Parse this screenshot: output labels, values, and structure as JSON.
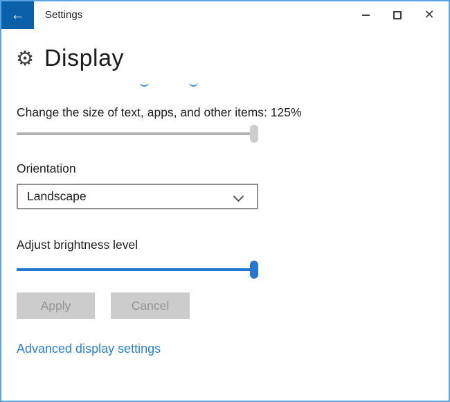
{
  "window": {
    "title": "Settings",
    "back_glyph": "←",
    "close_glyph": "✕",
    "border_color": "#56a4e8",
    "back_button_color": "#0b61a9"
  },
  "page": {
    "title": "Display",
    "icon": "gear-icon",
    "gear_glyph": "⚙",
    "clipped_link_marks": "two partially visible blue link-text descenders above first label"
  },
  "scaling": {
    "label": "Change the size of text, apps, and other items: 125%",
    "value_percent": "125%",
    "slider_position": "max",
    "slider_color": "#b1b1b1"
  },
  "orientation": {
    "label": "Orientation",
    "selected_option": "Landscape"
  },
  "brightness": {
    "label": "Adjust brightness level",
    "slider_position": "max",
    "slider_color": "#2478d0"
  },
  "buttons": {
    "apply_label": "Apply",
    "cancel_label": "Cancel",
    "state": "disabled",
    "background": "#cccccc"
  },
  "links": {
    "advanced_display_settings": "Advanced display settings",
    "link_color": "#2b7fd3"
  }
}
